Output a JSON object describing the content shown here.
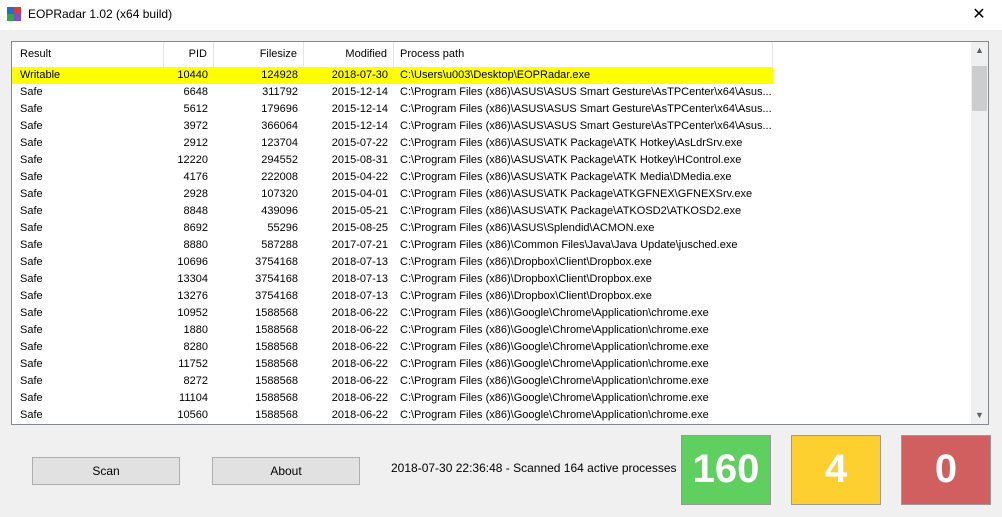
{
  "window": {
    "title": "EOPRadar 1.02 (x64 build)",
    "close_glyph": "✕",
    "icon": "app-icon"
  },
  "table": {
    "columns": [
      {
        "label": "Result",
        "align": "left"
      },
      {
        "label": "PID",
        "align": "right"
      },
      {
        "label": "Filesize",
        "align": "right"
      },
      {
        "label": "Modified",
        "align": "right"
      },
      {
        "label": "Process path",
        "align": "left"
      }
    ],
    "rows": [
      {
        "result": "Writable",
        "pid": "10440",
        "size": "124928",
        "modified": "2018-07-30",
        "path": "C:\\Users\\u003\\Desktop\\EOPRadar.exe",
        "highlight": true
      },
      {
        "result": "Safe",
        "pid": "6648",
        "size": "311792",
        "modified": "2015-12-14",
        "path": "C:\\Program Files (x86)\\ASUS\\ASUS Smart Gesture\\AsTPCenter\\x64\\Asus..."
      },
      {
        "result": "Safe",
        "pid": "5612",
        "size": "179696",
        "modified": "2015-12-14",
        "path": "C:\\Program Files (x86)\\ASUS\\ASUS Smart Gesture\\AsTPCenter\\x64\\Asus..."
      },
      {
        "result": "Safe",
        "pid": "3972",
        "size": "366064",
        "modified": "2015-12-14",
        "path": "C:\\Program Files (x86)\\ASUS\\ASUS Smart Gesture\\AsTPCenter\\x64\\Asus..."
      },
      {
        "result": "Safe",
        "pid": "2912",
        "size": "123704",
        "modified": "2015-07-22",
        "path": "C:\\Program Files (x86)\\ASUS\\ATK Package\\ATK Hotkey\\AsLdrSrv.exe"
      },
      {
        "result": "Safe",
        "pid": "12220",
        "size": "294552",
        "modified": "2015-08-31",
        "path": "C:\\Program Files (x86)\\ASUS\\ATK Package\\ATK Hotkey\\HControl.exe"
      },
      {
        "result": "Safe",
        "pid": "4176",
        "size": "222008",
        "modified": "2015-04-22",
        "path": "C:\\Program Files (x86)\\ASUS\\ATK Package\\ATK Media\\DMedia.exe"
      },
      {
        "result": "Safe",
        "pid": "2928",
        "size": "107320",
        "modified": "2015-04-01",
        "path": "C:\\Program Files (x86)\\ASUS\\ATK Package\\ATKGFNEX\\GFNEXSrv.exe"
      },
      {
        "result": "Safe",
        "pid": "8848",
        "size": "439096",
        "modified": "2015-05-21",
        "path": "C:\\Program Files (x86)\\ASUS\\ATK Package\\ATKOSD2\\ATKOSD2.exe"
      },
      {
        "result": "Safe",
        "pid": "8692",
        "size": "55296",
        "modified": "2015-08-25",
        "path": "C:\\Program Files (x86)\\ASUS\\Splendid\\ACMON.exe"
      },
      {
        "result": "Safe",
        "pid": "8880",
        "size": "587288",
        "modified": "2017-07-21",
        "path": "C:\\Program Files (x86)\\Common Files\\Java\\Java Update\\jusched.exe"
      },
      {
        "result": "Safe",
        "pid": "10696",
        "size": "3754168",
        "modified": "2018-07-13",
        "path": "C:\\Program Files (x86)\\Dropbox\\Client\\Dropbox.exe"
      },
      {
        "result": "Safe",
        "pid": "13304",
        "size": "3754168",
        "modified": "2018-07-13",
        "path": "C:\\Program Files (x86)\\Dropbox\\Client\\Dropbox.exe"
      },
      {
        "result": "Safe",
        "pid": "13276",
        "size": "3754168",
        "modified": "2018-07-13",
        "path": "C:\\Program Files (x86)\\Dropbox\\Client\\Dropbox.exe"
      },
      {
        "result": "Safe",
        "pid": "10952",
        "size": "1588568",
        "modified": "2018-06-22",
        "path": "C:\\Program Files (x86)\\Google\\Chrome\\Application\\chrome.exe"
      },
      {
        "result": "Safe",
        "pid": "1880",
        "size": "1588568",
        "modified": "2018-06-22",
        "path": "C:\\Program Files (x86)\\Google\\Chrome\\Application\\chrome.exe"
      },
      {
        "result": "Safe",
        "pid": "8280",
        "size": "1588568",
        "modified": "2018-06-22",
        "path": "C:\\Program Files (x86)\\Google\\Chrome\\Application\\chrome.exe"
      },
      {
        "result": "Safe",
        "pid": "11752",
        "size": "1588568",
        "modified": "2018-06-22",
        "path": "C:\\Program Files (x86)\\Google\\Chrome\\Application\\chrome.exe"
      },
      {
        "result": "Safe",
        "pid": "8272",
        "size": "1588568",
        "modified": "2018-06-22",
        "path": "C:\\Program Files (x86)\\Google\\Chrome\\Application\\chrome.exe"
      },
      {
        "result": "Safe",
        "pid": "11104",
        "size": "1588568",
        "modified": "2018-06-22",
        "path": "C:\\Program Files (x86)\\Google\\Chrome\\Application\\chrome.exe"
      },
      {
        "result": "Safe",
        "pid": "10560",
        "size": "1588568",
        "modified": "2018-06-22",
        "path": "C:\\Program Files (x86)\\Google\\Chrome\\Application\\chrome.exe"
      }
    ],
    "highlight_color": "#ffff00",
    "scroll_up_glyph": "▲",
    "scroll_down_glyph": "▼"
  },
  "controls": {
    "scan_label": "Scan",
    "about_label": "About",
    "status_text": "2018-07-30 22:36:48 - Scanned 164 active processes"
  },
  "counters": [
    {
      "name": "safe-count",
      "value": "160",
      "color": "#5fcf5f"
    },
    {
      "name": "warning-count",
      "value": "4",
      "color": "#fdcf2f"
    },
    {
      "name": "writable-count",
      "value": "0",
      "color": "#d25f5f"
    }
  ]
}
